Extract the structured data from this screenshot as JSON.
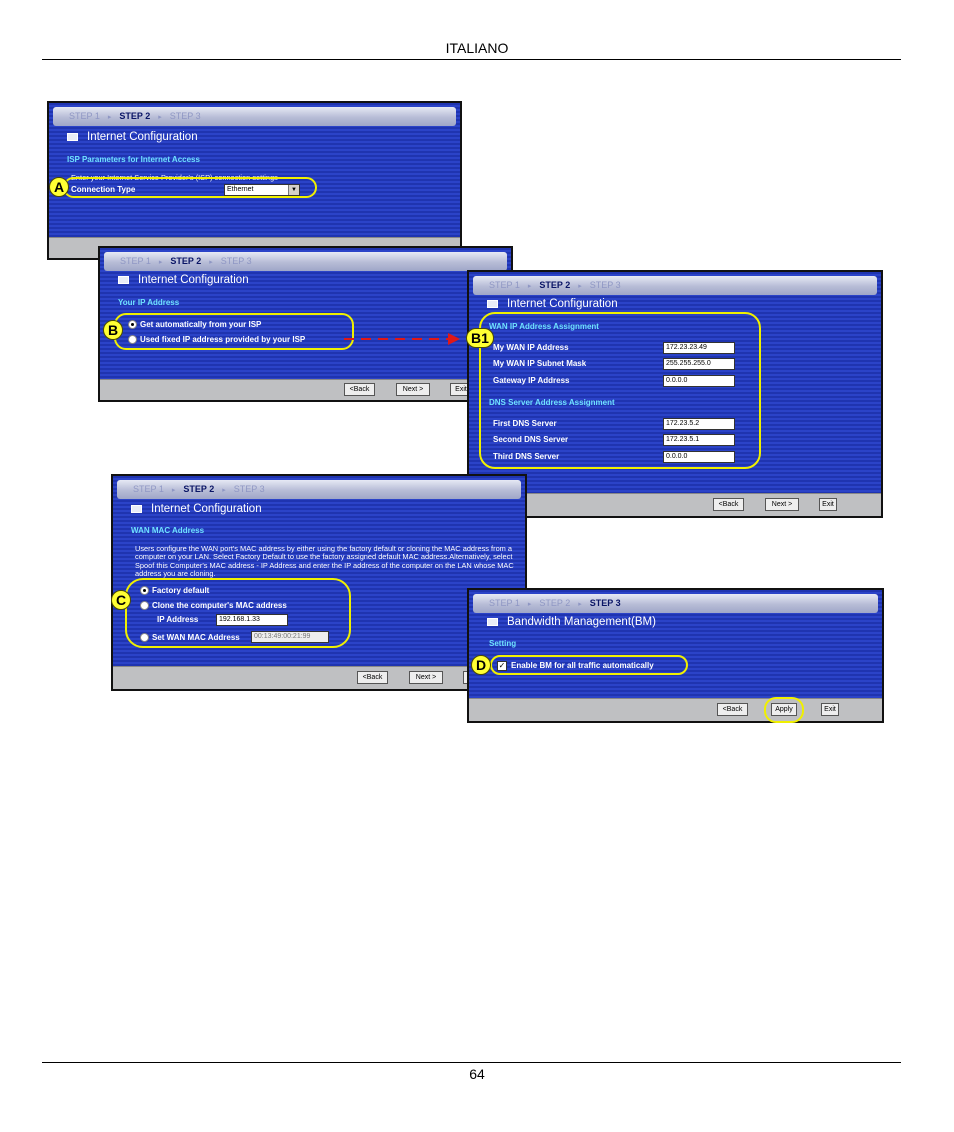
{
  "page": {
    "header": "ITALIANO",
    "page_number": "64"
  },
  "steps": {
    "step1": "STEP 1",
    "step2": "STEP 2",
    "step3": "STEP 3"
  },
  "buttons": {
    "back": "<Back",
    "next": "Next >",
    "exit": "Exit",
    "apply": "Apply"
  },
  "screen_a": {
    "title": "Internet Configuration",
    "section": "ISP Parameters for Internet Access",
    "description": "Enter your Internet Service Provider's (ISP) connection settings",
    "connection_type_label": "Connection Type",
    "connection_type_value": "Ethernet",
    "callout": "A"
  },
  "screen_b": {
    "title": "Internet Configuration",
    "section": "Your IP Address",
    "option_auto": "Get automatically from your ISP",
    "option_fixed": "Used fixed IP address provided by your ISP",
    "callout": "B"
  },
  "screen_b1": {
    "title": "Internet Configuration",
    "wan_section": "WAN IP Address Assignment",
    "my_wan_ip_label": "My WAN IP Address",
    "my_wan_ip_value": "172.23.23.49",
    "subnet_mask_label": "My WAN IP Subnet Mask",
    "subnet_mask_value": "255.255.255.0",
    "gateway_label": "Gateway IP Address",
    "gateway_value": "0.0.0.0",
    "dns_section": "DNS Server Address Assignment",
    "first_dns_label": "First DNS Server",
    "first_dns_value": "172.23.5.2",
    "second_dns_label": "Second DNS Server",
    "second_dns_value": "172.23.5.1",
    "third_dns_label": "Third DNS Server",
    "third_dns_value": "0.0.0.0",
    "callout": "B1"
  },
  "screen_c": {
    "title": "Internet Configuration",
    "section": "WAN MAC Address",
    "description": "Users configure the WAN port's MAC address by either using the factory default or cloning the MAC address from a computer on your LAN. Select Factory Default to use the factory assigned default MAC address.Alternatively, select Spoof this Computer's MAC address - IP Address and enter the IP address of the computer on the LAN whose MAC address you are cloning.",
    "option_factory": "Factory default",
    "option_clone": "Clone the computer's MAC address",
    "ip_address_label": "IP Address",
    "ip_address_value": "192.168.1.33",
    "option_set": "Set WAN MAC Address",
    "mac_value": "00:13:49:00:21:99",
    "callout": "C"
  },
  "screen_d": {
    "title": "Bandwidth Management(BM)",
    "section": "Setting",
    "enable_bm": "Enable BM for all traffic automatically",
    "callout": "D"
  }
}
